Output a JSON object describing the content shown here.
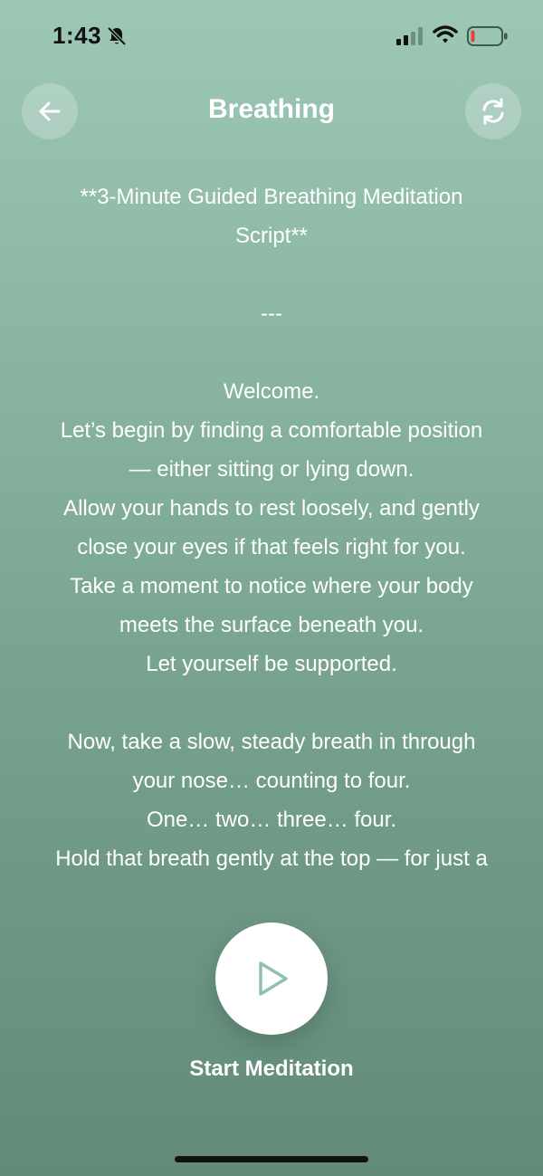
{
  "status_bar": {
    "time": "1:43",
    "icons": [
      "bell-slash-icon",
      "signal-icon",
      "wifi-icon",
      "battery-low-icon"
    ]
  },
  "header": {
    "title": "Breathing",
    "back_icon": "arrow-left-icon",
    "refresh_icon": "refresh-icon"
  },
  "script": {
    "title_line1": "**3-Minute Guided Breathing Meditation",
    "title_line2": "Script**",
    "divider": "---",
    "lines": [
      "Welcome.",
      "Let’s begin by finding a comfortable position",
      "— either sitting or lying down.",
      "Allow your hands to rest loosely, and gently",
      "close your eyes if that feels right for you.",
      "Take a moment to notice where your body",
      "meets the surface beneath you.",
      "Let yourself be supported.",
      "",
      "Now, take a slow, steady breath in through",
      "your nose… counting to four.",
      "One… two… three… four.",
      "Hold that breath gently at the top — for just a"
    ]
  },
  "player": {
    "play_icon": "play-icon",
    "start_label": "Start Meditation"
  },
  "colors": {
    "background_top": "#9ec8b6",
    "background_bottom": "#638a78",
    "accent": "#8fc2ad",
    "battery_low": "#e0443a"
  }
}
